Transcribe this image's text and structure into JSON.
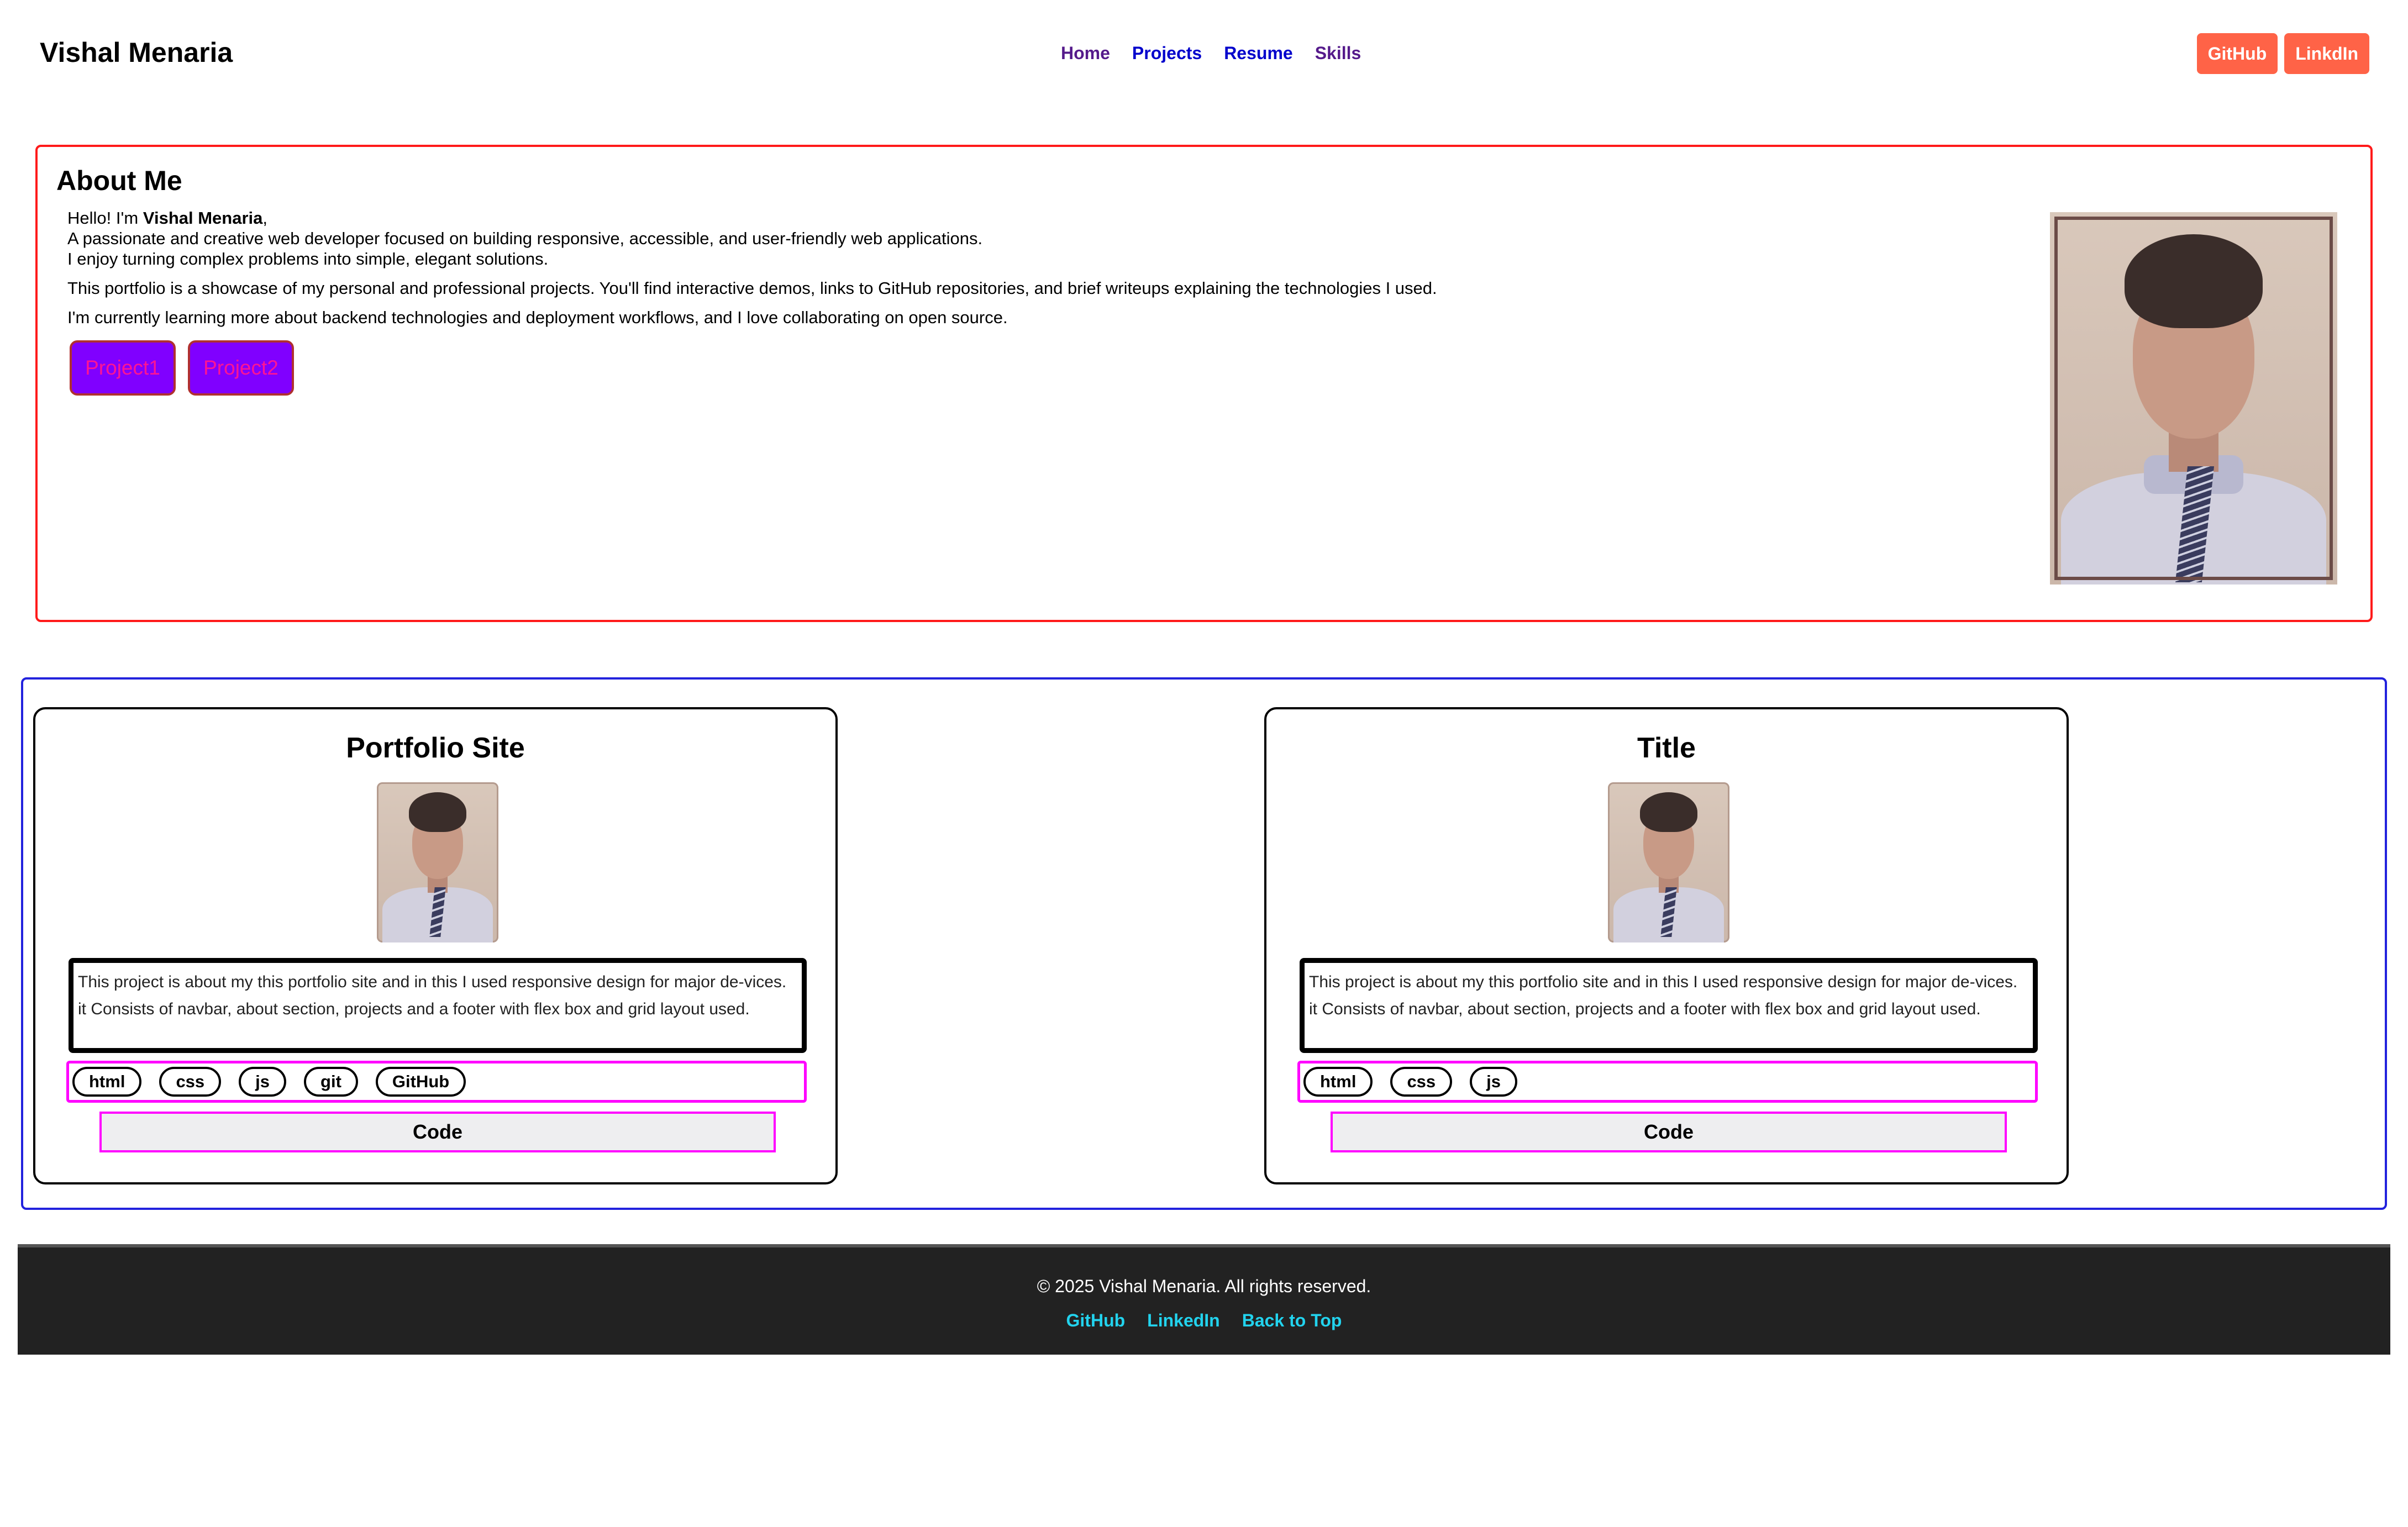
{
  "header": {
    "brand": "Vishal Menaria",
    "nav": [
      "Home",
      "Projects",
      "Resume",
      "Skills"
    ],
    "social": [
      "GitHub",
      "LinkdIn"
    ]
  },
  "about": {
    "title": "About Me",
    "hello": "Hello! I'm ",
    "name": "Vishal Menaria",
    "comma": ",",
    "line1": "A passionate and creative web developer focused on building responsive, accessible, and user-friendly web applications.",
    "line2": "I enjoy turning complex problems into simple, elegant solutions.",
    "para2": "This portfolio is a showcase of my personal and professional projects. You'll find interactive demos, links to GitHub repositories, and brief writeups explaining the technologies I used.",
    "para3": "I'm currently learning more about backend technologies and deployment workflows, and I love collaborating on open source.",
    "buttons": [
      "Project1",
      "Project2"
    ],
    "photo_icon": "portrait-photo-icon"
  },
  "projects": [
    {
      "title": "Portfolio Site",
      "desc1": "This project is about my this portfolio site and in this I used responsive design for major de-vices.",
      "desc2": "it Consists of navbar, about section, projects and a footer with flex box and grid layout used.",
      "tags": [
        "html",
        "css",
        "js",
        "git",
        "GitHub"
      ],
      "code": "Code"
    },
    {
      "title": "Title",
      "desc1": "This project is about my this portfolio site and in this I used responsive design for major de-vices.",
      "desc2": "it Consists of navbar, about section, projects and a footer with flex box and grid layout used.",
      "tags": [
        "html",
        "css",
        "js"
      ],
      "code": "Code"
    }
  ],
  "footer": {
    "copyright": "© 2025 Vishal Menaria. All rights reserved.",
    "links": [
      "GitHub",
      "LinkedIn",
      "Back to Top"
    ]
  },
  "colors": {
    "accent_button": "#ff6347",
    "about_border": "#ff1a1a",
    "projects_border": "#2222dd",
    "project_button_bg": "#8000ff",
    "project_button_text": "#ff1493",
    "tag_border": "#ff00ff",
    "footer_bg": "#222222",
    "footer_link": "#22d3ee"
  }
}
